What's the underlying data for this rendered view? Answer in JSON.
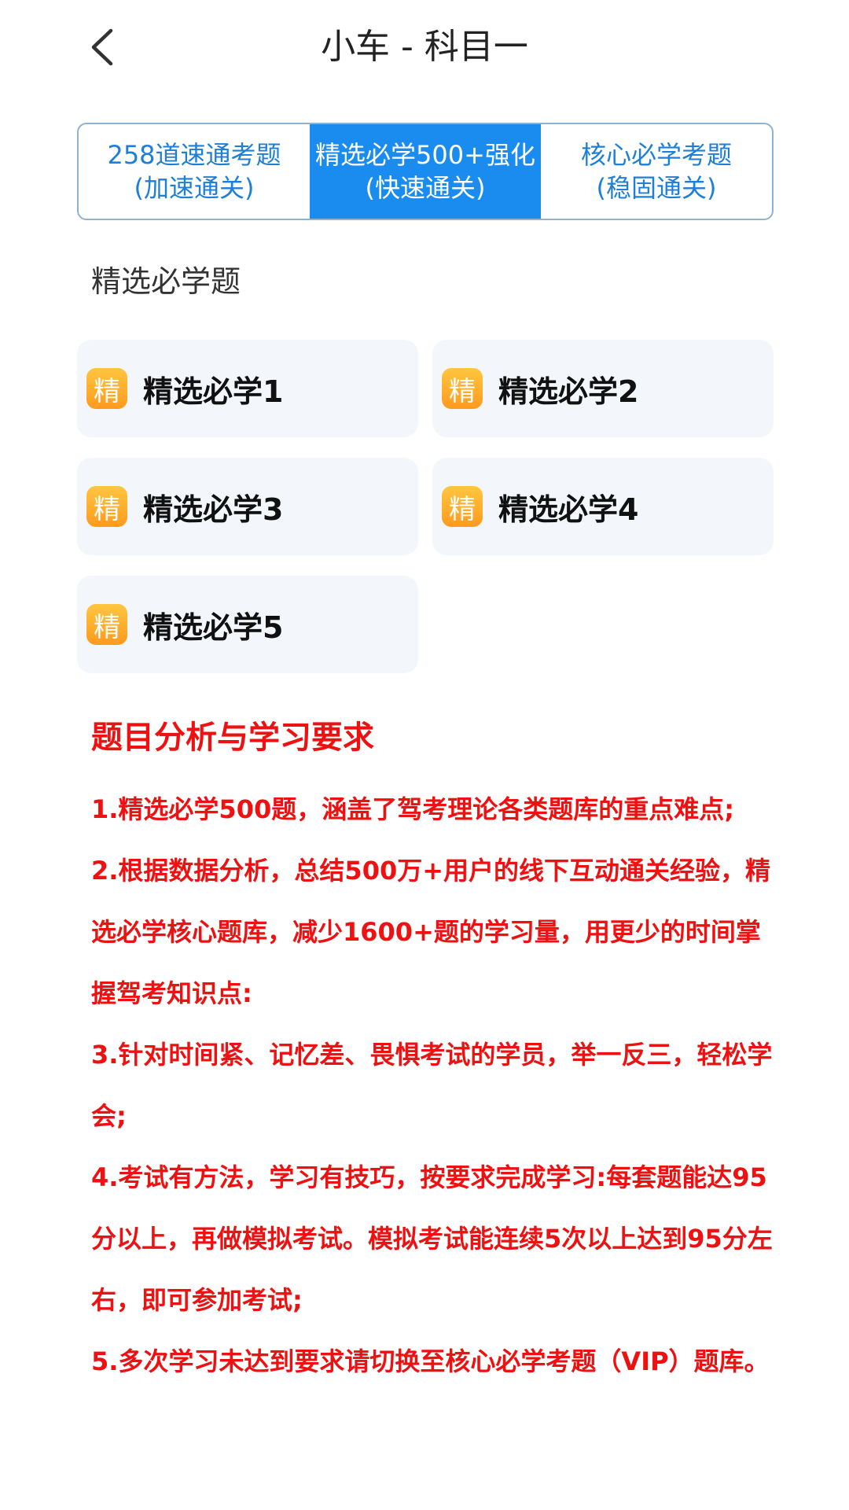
{
  "header": {
    "title": "小车 - 科目一",
    "back_icon": "chevron-left-icon"
  },
  "tabs": [
    {
      "line1": "258道速通考题",
      "line2": "(加速通关)",
      "active": false
    },
    {
      "line1": "精选必学500+强化",
      "line2": "(快速通关)",
      "active": true
    },
    {
      "line1": "核心必学考题",
      "line2": "(稳固通关)",
      "active": false
    }
  ],
  "section": {
    "title": "精选必学题"
  },
  "cards": [
    {
      "badge": "精",
      "label": "精选必学1"
    },
    {
      "badge": "精",
      "label": "精选必学2"
    },
    {
      "badge": "精",
      "label": "精选必学3"
    },
    {
      "badge": "精",
      "label": "精选必学4"
    },
    {
      "badge": "精",
      "label": "精选必学5"
    }
  ],
  "analysis": {
    "title": "题目分析与学习要求",
    "items": [
      "1.精选必学500题，涵盖了驾考理论各类题库的重点难点;",
      "2.根据数据分析，总结500万+用户的线下互动通关经验，精选必学核心题库，减少1600+题的学习量，用更少的时间掌握驾考知识点:",
      "3.针对时间紧、记忆差、畏惧考试的学员，举一反三，轻松学会;",
      "4.考试有方法，学习有技巧，按要求完成学习:每套题能达95分以上，再做模拟考试。模拟考试能连续5次以上达到95分左右，即可参加考试;",
      "5.多次学习未达到要求请切换至核心必学考题（VIP）题库。"
    ]
  },
  "colors": {
    "accent": "#1a8cf0",
    "tab_text": "#1d7fd8",
    "badge": "#ffb030",
    "analysis_text": "#ee1111",
    "card_bg": "#f3f7fc"
  }
}
